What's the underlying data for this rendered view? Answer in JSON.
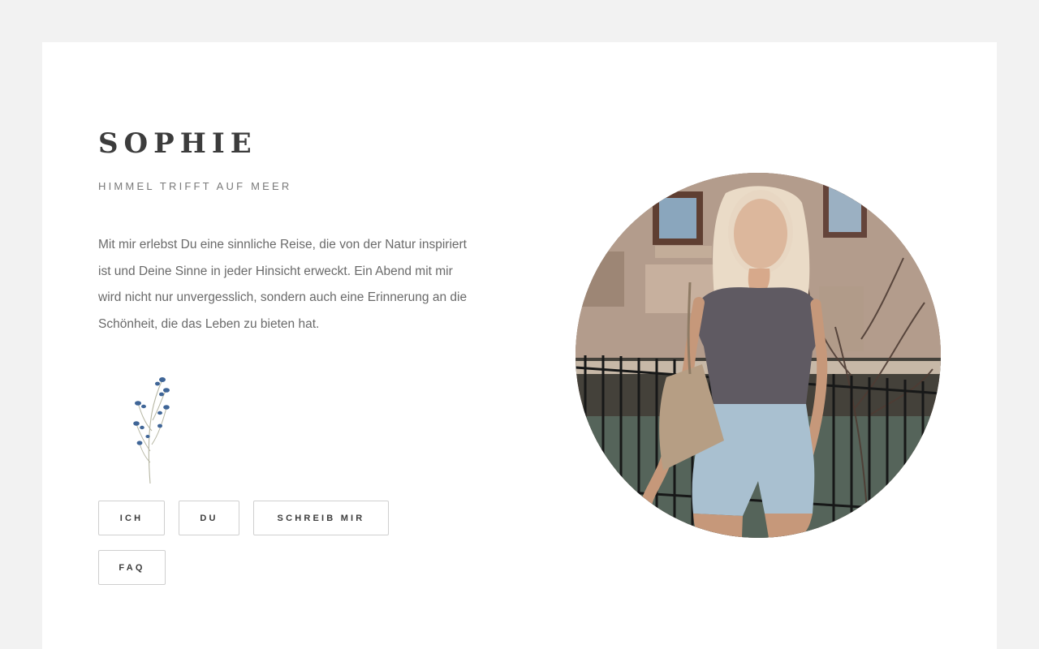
{
  "profile": {
    "name": "SOPHIE",
    "tagline": "HIMMEL TRIFFT AUF MEER",
    "intro": "Mit mir erlebst Du eine sinnliche Reise, die von der Natur inspiriert ist und Deine Sinne in jeder Hinsicht erweckt. Ein Abend mit mir wird nicht nur unvergesslich, sondern auch eine Erinnerung an die Schönheit, die das Leben zu bieten hat."
  },
  "nav": {
    "ich": "ICH",
    "du": "DU",
    "schreib_mir": "SCHREIB MIR",
    "faq": "FAQ"
  },
  "decor": {
    "flower_icon": "blue-wildflower-sprig-icon"
  },
  "colors": {
    "page_background": "#f2f2f2",
    "card_background": "#ffffff",
    "heading": "#3c3c3c",
    "body_text": "#6a6a6a",
    "button_border": "#cfcfcf",
    "flower_blue": "#3f6597"
  }
}
